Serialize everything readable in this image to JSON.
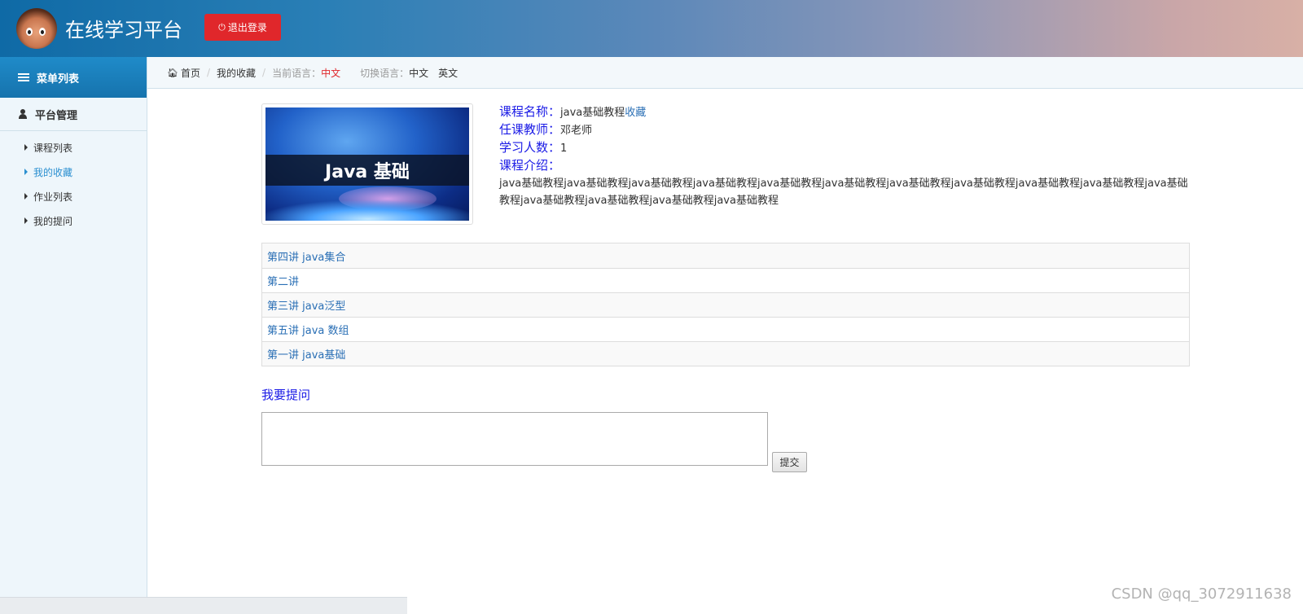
{
  "header": {
    "site_title": "在线学习平台",
    "logout_label": "退出登录",
    "accent": "#e0272b"
  },
  "sidebar": {
    "menu_title": "菜单列表",
    "section_title": "平台管理",
    "items": [
      {
        "label": "课程列表",
        "active": false
      },
      {
        "label": "我的收藏",
        "active": true
      },
      {
        "label": "作业列表",
        "active": false
      },
      {
        "label": "我的提问",
        "active": false
      }
    ]
  },
  "breadcrumb": {
    "home": "首页",
    "current": "我的收藏",
    "current_lang_label": "当前语言：",
    "current_lang_value": "中文",
    "switch_lang_label": "切换语言：",
    "lang_zh": "中文",
    "lang_en": "英文"
  },
  "course": {
    "image_text": "Java 基础",
    "name_label": "课程名称：",
    "name_value": "java基础教程",
    "favorite_link": "收藏",
    "teacher_label": "任课教师：",
    "teacher_value": "邓老师",
    "students_label": "学习人数：",
    "students_value": "1",
    "intro_label": "课程介绍：",
    "intro_text": "java基础教程java基础教程java基础教程java基础教程java基础教程java基础教程java基础教程java基础教程java基础教程java基础教程java基础教程java基础教程java基础教程java基础教程java基础教程"
  },
  "lessons": [
    "第四讲 java集合",
    "第二讲",
    "第三讲 java泛型",
    "第五讲 java 数组",
    "第一讲 java基础"
  ],
  "ask": {
    "title": "我要提问",
    "input_value": "",
    "submit_label": "提交"
  },
  "watermark": "CSDN @qq_3072911638"
}
